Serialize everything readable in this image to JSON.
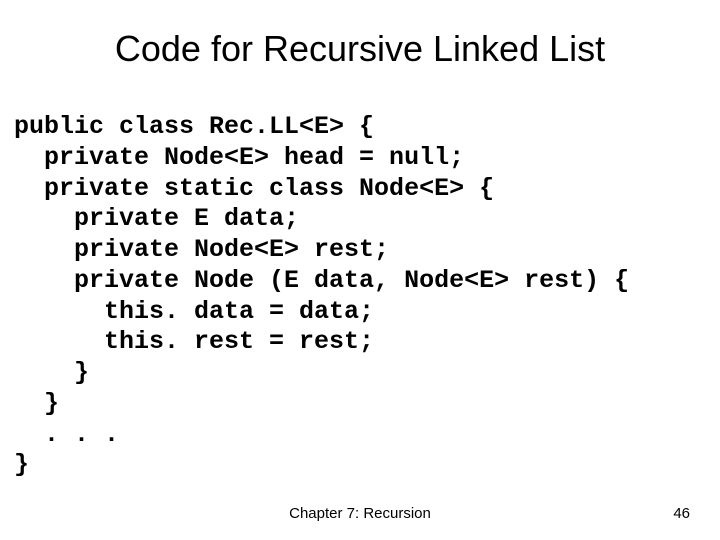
{
  "title": "Code for Recursive Linked List",
  "code": "public class Rec.LL<E> {\n  private Node<E> head = null;\n  private static class Node<E> {\n    private E data;\n    private Node<E> rest;\n    private Node (E data, Node<E> rest) {\n      this. data = data;\n      this. rest = rest;\n    }\n  }\n  . . .\n}",
  "footer": {
    "chapter": "Chapter 7: Recursion",
    "page": "46"
  },
  "chart_data": null
}
